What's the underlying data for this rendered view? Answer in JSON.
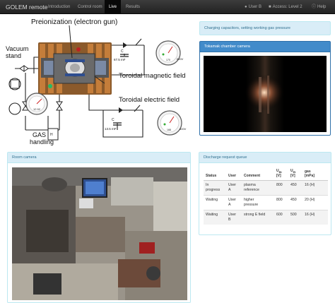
{
  "navbar": {
    "brand": "GOLEM remote",
    "items": [
      {
        "label": "Introduction",
        "active": false
      },
      {
        "label": "Control room",
        "active": false
      },
      {
        "label": "Live",
        "active": true
      },
      {
        "label": "Results",
        "active": false
      }
    ],
    "user": "User B",
    "access": "Access: Level 2",
    "help": "Help"
  },
  "diagram": {
    "preionization": "Preionization (electron gun)",
    "vacuum_stand_1": "Vacuum",
    "vacuum_stand_2": "stand",
    "toroidal_magnetic": "Toroidal magnetic field",
    "toroidal_electric": "Toroidal electric field",
    "gas_1": "GAS",
    "gas_2": "handling",
    "h2": "H",
    "cap_top_label": "C",
    "cap_top_value": "67.5 mF",
    "cap_bottom_label": "C",
    "cap_bottom_value": "13.5 mF",
    "gauge_top_value": "170",
    "gauge_top_volts": "600V",
    "gauge_bottom_value": "168",
    "gauge_bottom_volts": "600V",
    "pressure_value": "12.92"
  },
  "status_alert": "Charging capacitors, setting working gas pressure",
  "tokamak_panel": {
    "title": "Tokamak chamber camera"
  },
  "room_panel": {
    "title": "Room camera"
  },
  "queue_panel": {
    "title": "Discharge request queue",
    "headers": {
      "status": "Status",
      "user": "User",
      "comment": "Comment",
      "ub_main": "U",
      "ub_sub": "Bt",
      "ub_unit": "[V]",
      "ue_main": "U",
      "ue_sub": "Et",
      "ue_unit": "[V]",
      "gas_main": "gas",
      "gas_unit": "[mPa]"
    },
    "rows": [
      {
        "status_1": "In",
        "status_2": "progress",
        "user_1": "User",
        "user_2": "A",
        "comment_1": "plasma",
        "comment_2": "reference",
        "ub": "800",
        "ue": "450",
        "gas": "16 (H)"
      },
      {
        "status_1": "Waiting",
        "status_2": "",
        "user_1": "User",
        "user_2": "A",
        "comment_1": "higher",
        "comment_2": "pressure",
        "ub": "800",
        "ue": "450",
        "gas": "20 (H)"
      },
      {
        "status_1": "Waiting",
        "status_2": "",
        "user_1": "User",
        "user_2": "B",
        "comment_1": "strong E field",
        "comment_2": "",
        "ub": "600",
        "ue": "500",
        "gas": "16 (H)"
      }
    ]
  },
  "colors": {
    "navbar": "#222222",
    "info_bg": "#d9edf7",
    "info_text": "#31708f",
    "primary": "#428bca"
  }
}
